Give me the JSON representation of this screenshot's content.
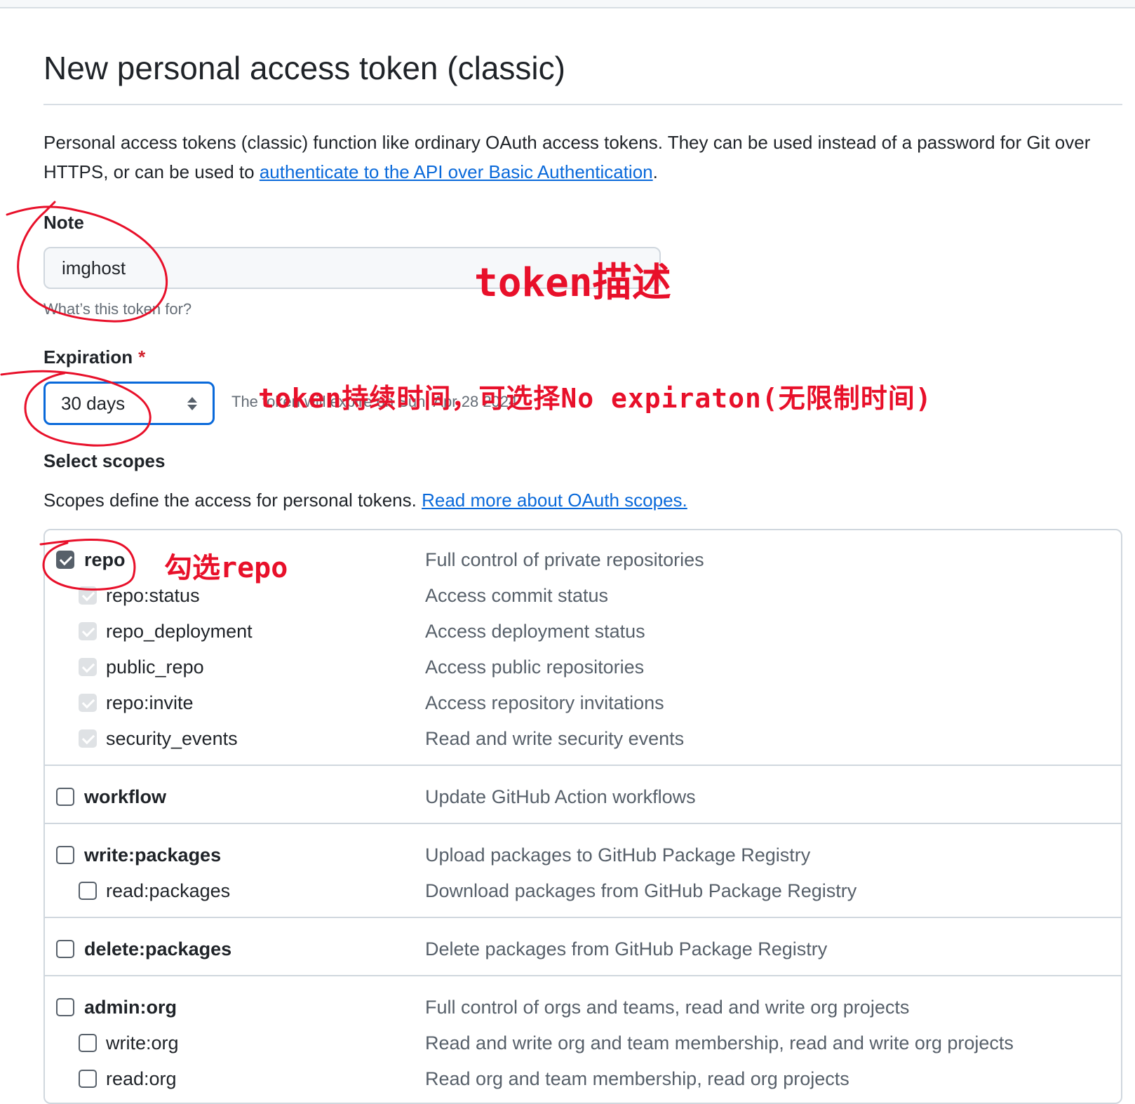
{
  "page": {
    "title": "New personal access token (classic)",
    "intro_text": "Personal access tokens (classic) function like ordinary OAuth access tokens. They can be used instead of a password for Git over HTTPS, or can be used to ",
    "intro_link": "authenticate to the API over Basic Authentication",
    "intro_end": "."
  },
  "note": {
    "label": "Note",
    "value": "imghost",
    "hint": "What’s this token for?"
  },
  "expiration": {
    "label": "Expiration",
    "required_mark": "*",
    "selected": "30 days",
    "hint": "The token will expire on Sun, Apr 28 2024"
  },
  "scopes": {
    "heading": "Select scopes",
    "description": "Scopes define the access for personal tokens. ",
    "link": "Read more about OAuth scopes.",
    "groups": [
      {
        "name": "repo",
        "description": "Full control of private repositories",
        "checked": true,
        "children": [
          {
            "name": "repo:status",
            "description": "Access commit status",
            "checked": true
          },
          {
            "name": "repo_deployment",
            "description": "Access deployment status",
            "checked": true
          },
          {
            "name": "public_repo",
            "description": "Access public repositories",
            "checked": true
          },
          {
            "name": "repo:invite",
            "description": "Access repository invitations",
            "checked": true
          },
          {
            "name": "security_events",
            "description": "Read and write security events",
            "checked": true
          }
        ]
      },
      {
        "name": "workflow",
        "description": "Update GitHub Action workflows",
        "checked": false,
        "children": []
      },
      {
        "name": "write:packages",
        "description": "Upload packages to GitHub Package Registry",
        "checked": false,
        "children": [
          {
            "name": "read:packages",
            "description": "Download packages from GitHub Package Registry",
            "checked": false
          }
        ]
      },
      {
        "name": "delete:packages",
        "description": "Delete packages from GitHub Package Registry",
        "checked": false,
        "children": []
      },
      {
        "name": "admin:org",
        "description": "Full control of orgs and teams, read and write org projects",
        "checked": false,
        "children": [
          {
            "name": "write:org",
            "description": "Read and write org and team membership, read and write org projects",
            "checked": false
          },
          {
            "name": "read:org",
            "description": "Read org and team membership, read org projects",
            "checked": false
          }
        ]
      }
    ]
  },
  "annotations": {
    "token_desc": "token描述",
    "token_duration": "token持续时间，可选择No expiraton(无限制时间)",
    "check_repo": "勾选repo",
    "color": "#e8102a"
  }
}
